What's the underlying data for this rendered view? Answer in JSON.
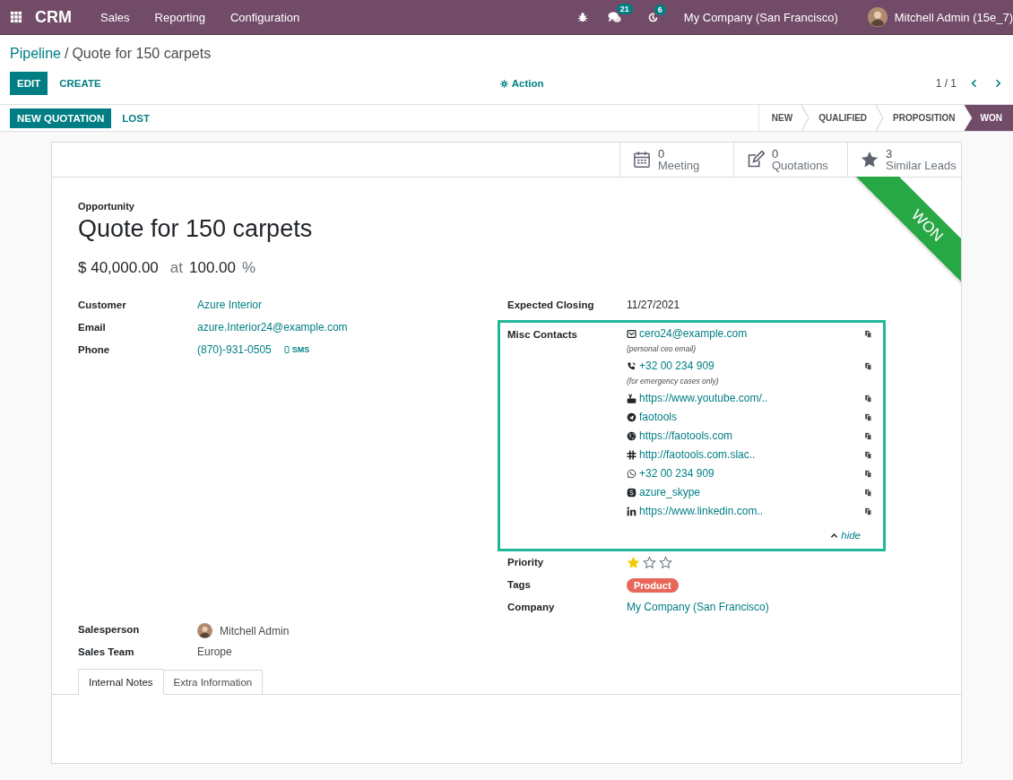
{
  "navbar": {
    "app": "CRM",
    "menus": [
      "Sales",
      "Reporting",
      "Configuration"
    ],
    "messages_count": "21",
    "activities_count": "6",
    "company": "My Company (San Francisco)",
    "user": "Mitchell Admin (15e_7)"
  },
  "breadcrumb": {
    "parent": "Pipeline",
    "separator": "/",
    "current": "Quote for 150 carpets"
  },
  "control": {
    "edit": "EDIT",
    "create": "CREATE",
    "action": "Action",
    "pager": "1 / 1"
  },
  "statusbar": {
    "buttons": [
      {
        "label": "NEW QUOTATION",
        "kind": "primary"
      },
      {
        "label": "LOST",
        "kind": "secondary"
      }
    ],
    "stages": [
      {
        "label": "NEW",
        "selected": false
      },
      {
        "label": "QUALIFIED",
        "selected": false
      },
      {
        "label": "PROPOSITION",
        "selected": false
      },
      {
        "label": "WON",
        "selected": true
      }
    ]
  },
  "stat_buttons": [
    {
      "kind": "calendar",
      "value": "0",
      "label": "Meeting"
    },
    {
      "kind": "edit",
      "value": "0",
      "label": "Quotations"
    },
    {
      "kind": "star",
      "value": "3",
      "label": "Similar Leads"
    }
  ],
  "ribbon": "WON",
  "record": {
    "type_label": "Opportunity",
    "name": "Quote for 150 carpets",
    "revenue": "$ 40,000.00",
    "at": "at",
    "probability": "100.00",
    "percent": "%"
  },
  "left_fields": [
    {
      "label": "Customer",
      "value": "Azure Interior",
      "kind": "link"
    },
    {
      "label": "Email",
      "value": "azure.Interior24@example.com",
      "kind": "link"
    },
    {
      "label": "Phone",
      "value": "(870)-931-0505",
      "kind": "phone",
      "sms": "SMS"
    }
  ],
  "left_fields_2": [
    {
      "label": "Salesperson",
      "value": "Mitchell Admin",
      "kind": "user"
    },
    {
      "label": "Sales Team",
      "value": "Europe",
      "kind": "text"
    }
  ],
  "expected_closing": {
    "label": "Expected Closing",
    "value": "11/27/2021"
  },
  "misc_contacts": {
    "label": "Misc Contacts",
    "toggle": "hide",
    "items": [
      {
        "kind": "email",
        "value": "cero24@example.com",
        "note": "(personal ceo email)"
      },
      {
        "kind": "phone",
        "value": "+32 00 234 909",
        "note": "(for emergency cases only)"
      },
      {
        "kind": "youtube",
        "value": "https://www.youtube.com/.."
      },
      {
        "kind": "telegram",
        "value": "faotools"
      },
      {
        "kind": "website",
        "value": "https://faotools.com"
      },
      {
        "kind": "slack",
        "value": "http://faotools.com.slac.."
      },
      {
        "kind": "whatsapp",
        "value": "+32 00 234 909"
      },
      {
        "kind": "skype",
        "value": "azure_skype"
      },
      {
        "kind": "linkedin",
        "value": "https://www.linkedin.com.."
      }
    ]
  },
  "right_fields": [
    {
      "label": "Priority",
      "kind": "priority",
      "stars": 1
    },
    {
      "label": "Tags",
      "kind": "tags",
      "tags": [
        {
          "label": "Product",
          "color": "#e7685a"
        }
      ]
    },
    {
      "label": "Company",
      "kind": "link",
      "value": "My Company (San Francisco)"
    }
  ],
  "tabs": [
    {
      "label": "Internal Notes",
      "selected": true
    },
    {
      "label": "Extra Information",
      "selected": false
    }
  ]
}
